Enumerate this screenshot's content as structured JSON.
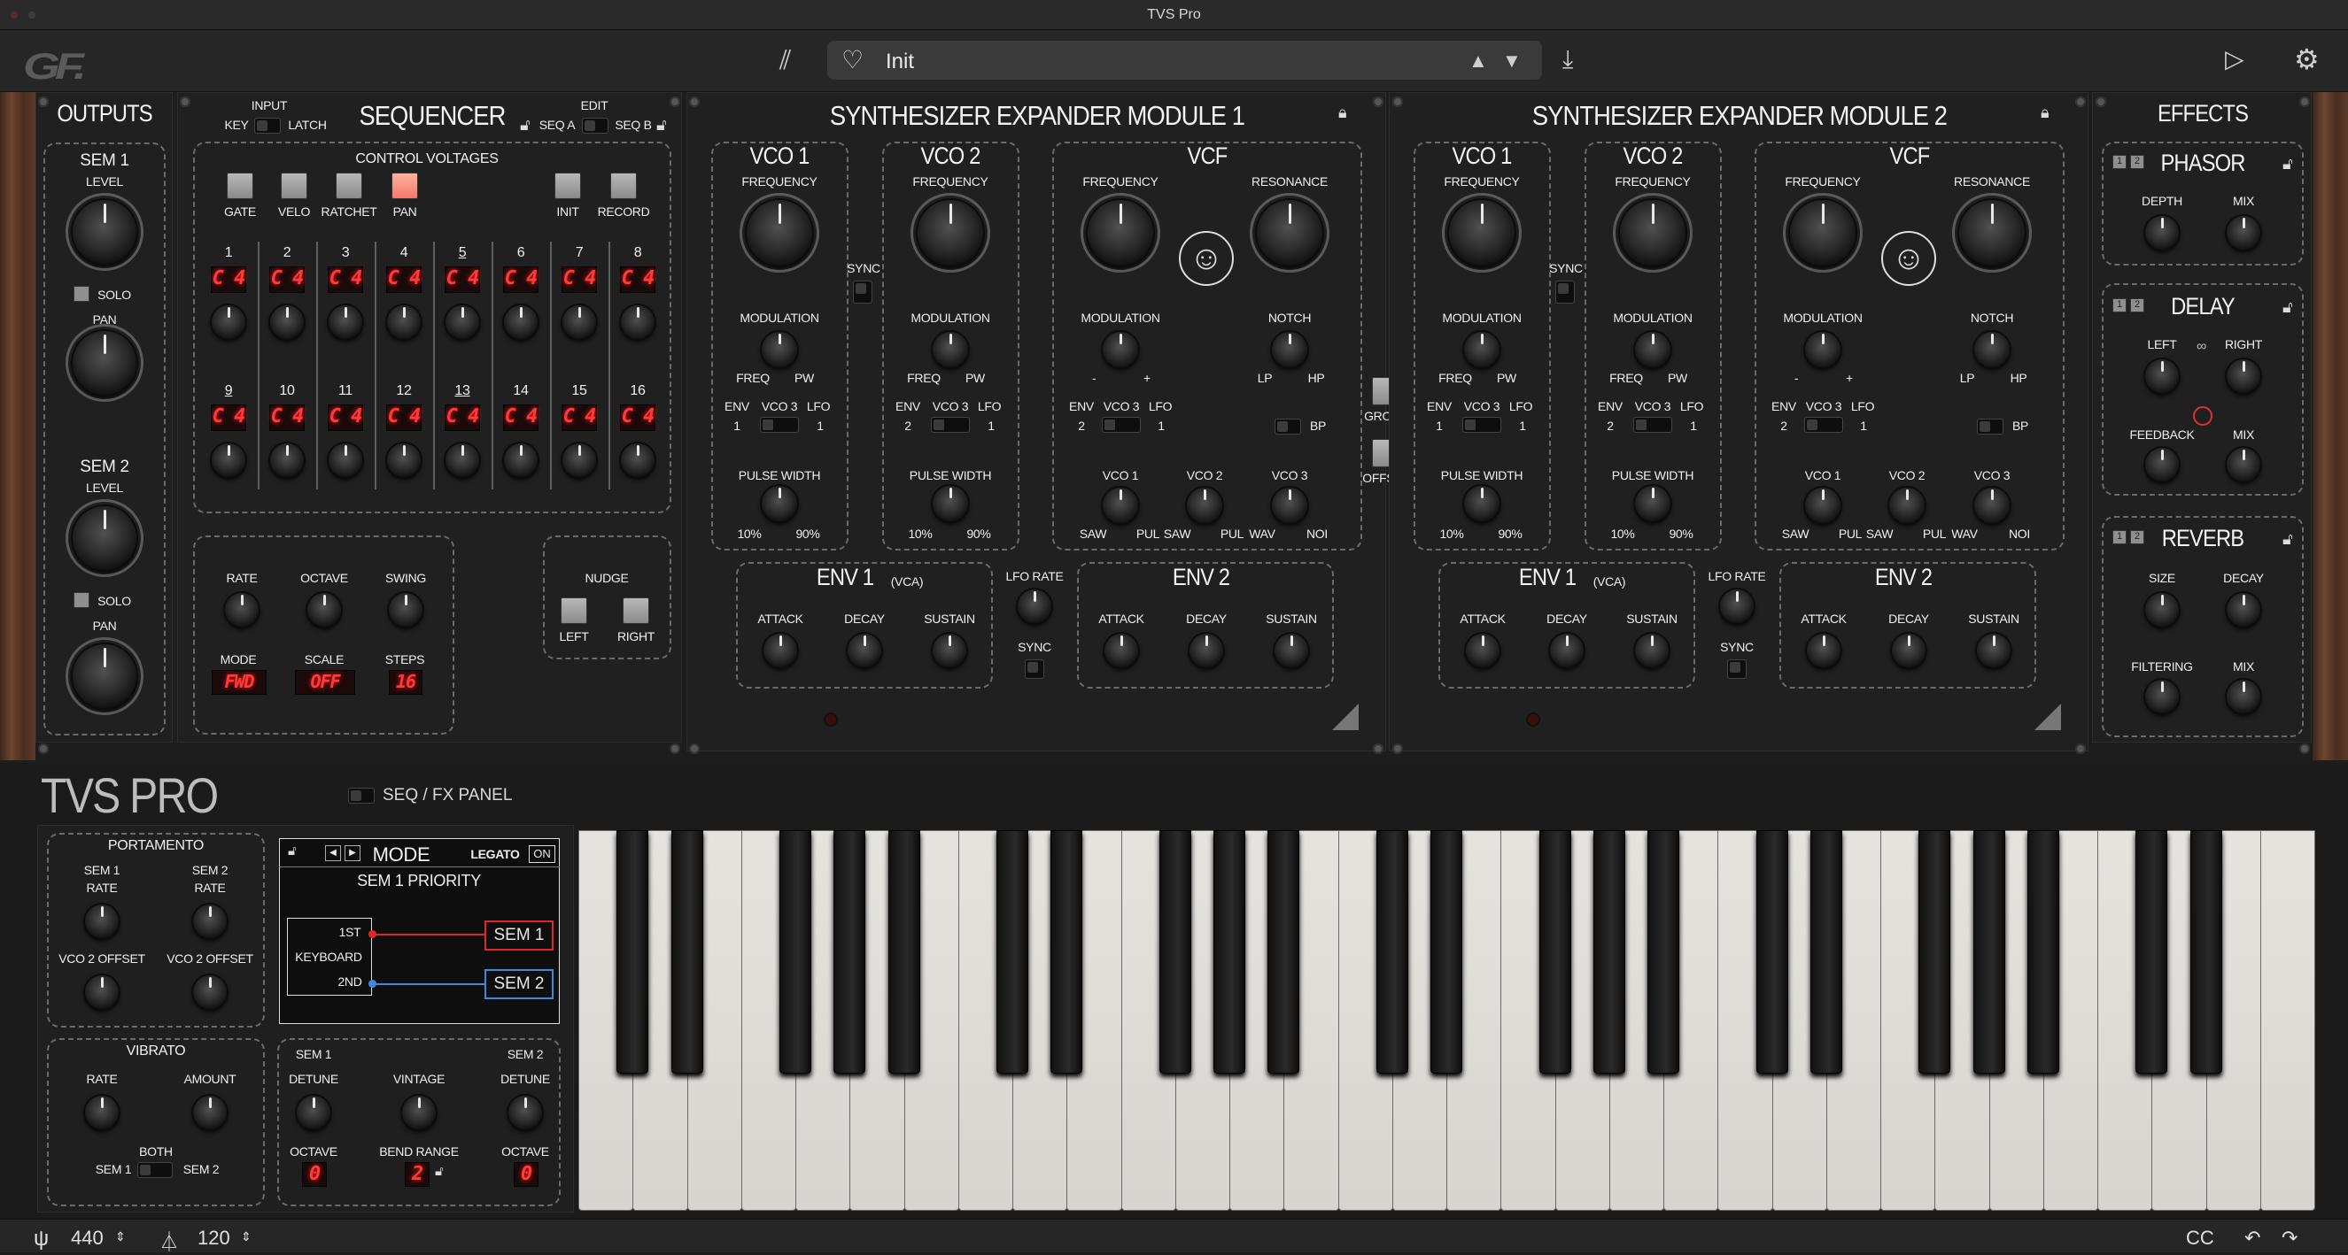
{
  "window": {
    "title": "TVS Pro"
  },
  "header": {
    "logo": "GF.",
    "preset_name": "Init"
  },
  "outputs": {
    "title": "OUTPUTS",
    "sem1": "SEM 1",
    "sem2": "SEM 2",
    "level": "LEVEL",
    "solo": "SOLO",
    "pan": "PAN"
  },
  "sequencer": {
    "title": "SEQUENCER",
    "input": "INPUT",
    "key": "KEY",
    "latch": "LATCH",
    "edit": "EDIT",
    "seq_a": "SEQ A",
    "seq_b": "SEQ B",
    "cv_title": "CONTROL VOLTAGES",
    "gate": "GATE",
    "velo": "VELO",
    "ratchet": "RATCHET",
    "pan": "PAN",
    "init": "INIT",
    "record": "RECORD",
    "steps_top": [
      "1",
      "2",
      "3",
      "4",
      "5",
      "6",
      "7",
      "8"
    ],
    "steps_bottom": [
      "9",
      "10",
      "11",
      "12",
      "13",
      "14",
      "15",
      "16"
    ],
    "note": "C 4",
    "rate": "RATE",
    "octave": "OCTAVE",
    "swing": "SWING",
    "mode": "MODE",
    "scale": "SCALE",
    "steps": "STEPS",
    "mode_val": "FWD",
    "scale_val": "OFF",
    "steps_val": "16",
    "nudge": "NUDGE",
    "left": "LEFT",
    "right": "RIGHT"
  },
  "module1": {
    "title": "SYNTHESIZER EXPANDER MODULE 1"
  },
  "module2": {
    "title": "SYNTHESIZER EXPANDER MODULE 2"
  },
  "module": {
    "vco1": "VCO 1",
    "vco2": "VCO 2",
    "vcf": "VCF",
    "frequency": "FREQUENCY",
    "resonance": "RESONANCE",
    "modulation": "MODULATION",
    "freq": "FREQ",
    "pw": "PW",
    "notch": "NOTCH",
    "lp": "LP",
    "hp": "HP",
    "bp": "BP",
    "minus": "-",
    "plus": "+",
    "sync": "SYNC",
    "env": "ENV",
    "vco3": "VCO 3",
    "lfo": "LFO",
    "one": "1",
    "two": "2",
    "pulse_width": "PULSE WIDTH",
    "p10": "10%",
    "p90": "90%",
    "saw": "SAW",
    "pul": "PUL",
    "wav": "WAV",
    "noi": "NOI",
    "env1": "ENV 1",
    "vca": "(VCA)",
    "env2": "ENV 2",
    "attack": "ATTACK",
    "decay": "DECAY",
    "sustain": "SUSTAIN",
    "lfo_rate": "LFO RATE"
  },
  "middle": {
    "group": "GROUP",
    "offset": "OFFSET"
  },
  "effects": {
    "title": "EFFECTS",
    "phasor": "PHASOR",
    "depth": "DEPTH",
    "mix": "MIX",
    "delay": "DELAY",
    "left": "LEFT",
    "right": "RIGHT",
    "feedback": "FEEDBACK",
    "reverb": "REVERB",
    "size": "SIZE",
    "decay": "DECAY",
    "filtering": "FILTERING",
    "one": "1",
    "two": "2"
  },
  "bottom": {
    "brand": "TVS PRO",
    "seq_fx": "SEQ / FX PANEL",
    "portamento": "PORTAMENTO",
    "sem1": "SEM 1",
    "sem2": "SEM 2",
    "rate": "RATE",
    "vco2_offset": "VCO 2 OFFSET",
    "vibrato": "VIBRATO",
    "amount": "AMOUNT",
    "both": "BOTH",
    "mode": "MODE",
    "legato": "LEGATO",
    "on": "ON",
    "priority": "SEM 1 PRIORITY",
    "first": "1ST",
    "keyboard": "KEYBOARD",
    "second": "2ND",
    "detune": "DETUNE",
    "vintage": "VINTAGE",
    "octave": "OCTAVE",
    "bend_range": "BEND RANGE",
    "oct1": "0",
    "bend": "2",
    "oct2": "0"
  },
  "status": {
    "tuning": "440",
    "tempo": "120",
    "cc": "CC"
  }
}
